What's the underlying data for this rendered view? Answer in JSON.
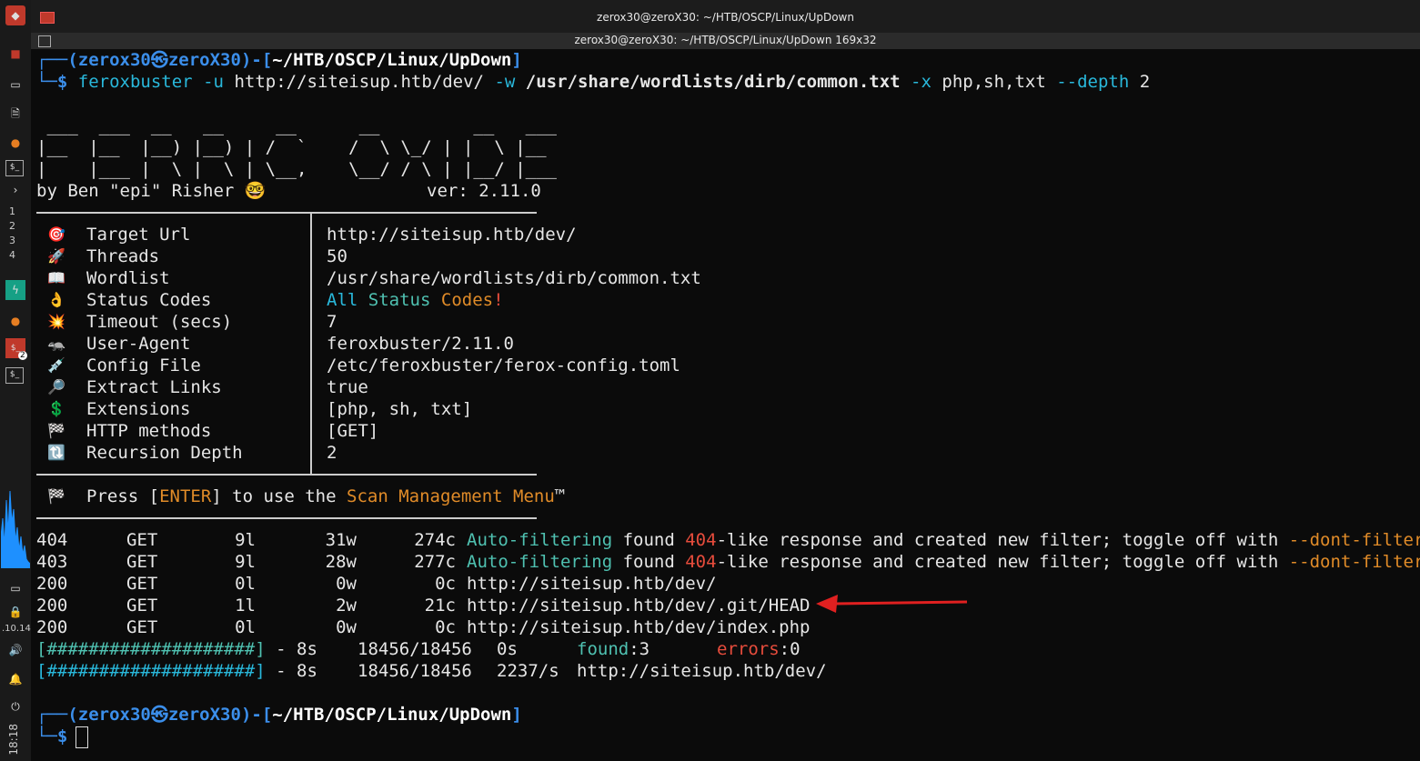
{
  "window": {
    "title": "zerox30@zeroX30: ~/HTB/OSCP/Linux/UpDown",
    "tab_title": "zerox30@zeroX30: ~/HTB/OSCP/Linux/UpDown 169x32"
  },
  "taskbar": {
    "workspaces": [
      "1",
      "2",
      "3",
      "4"
    ],
    "ip": ".10.14",
    "clock": "18:18",
    "badge": "2"
  },
  "prompt": {
    "user": "zerox30",
    "host": "zeroX30",
    "at_symbol": "㉿",
    "path": "~/HTB/OSCP/Linux/UpDown",
    "symbol": "$"
  },
  "command": {
    "bin": "feroxbuster",
    "flag_u": "-u",
    "url": "http://siteisup.htb/dev/",
    "flag_w": "-w",
    "wordlist": "/usr/share/wordlists/dirb/common.txt",
    "flag_x": "-x",
    "exts": "php,sh,txt",
    "flag_depth": "--depth",
    "depth": "2"
  },
  "banner": {
    "art1": " ___  ___  __   __     __      __         __   ___",
    "art2": "|__  |__  |__) |__) | /  `    /  \\ \\_/ | |  \\ |__",
    "art3": "|    |___ |  \\ |  \\ | \\__,    \\__/ / \\ | |__/ |___",
    "author": "by Ben \"epi\" Risher 🤓",
    "version": "ver: 2.11.0"
  },
  "config": [
    {
      "icon": "🎯",
      "label": "Target Url",
      "value": "http://siteisup.htb/dev/"
    },
    {
      "icon": "🚀",
      "label": "Threads",
      "value": "50"
    },
    {
      "icon": "📖",
      "label": "Wordlist",
      "value": "/usr/share/wordlists/dirb/common.txt"
    },
    {
      "icon": "👌",
      "label": "Status Codes",
      "value": ""
    },
    {
      "icon": "💥",
      "label": "Timeout (secs)",
      "value": "7"
    },
    {
      "icon": "🦡",
      "label": "User-Agent",
      "value": "feroxbuster/2.11.0"
    },
    {
      "icon": "💉",
      "label": "Config File",
      "value": "/etc/feroxbuster/ferox-config.toml"
    },
    {
      "icon": "🔎",
      "label": "Extract Links",
      "value": "true"
    },
    {
      "icon": "💲",
      "label": "Extensions",
      "value": "[php, sh, txt]"
    },
    {
      "icon": "🏁",
      "label": "HTTP methods",
      "value": "[GET]"
    },
    {
      "icon": "🔃",
      "label": "Recursion Depth",
      "value": "2"
    }
  ],
  "status_codes": {
    "all": "All",
    "status": "Status",
    "codes": "Codes",
    "bang": "!"
  },
  "press": {
    "icon": "🏁",
    "pre": "Press [",
    "key": "ENTER",
    "mid": "] to use the ",
    "menu": "Scan Management Menu",
    "tm": "™"
  },
  "results": [
    {
      "code": "404",
      "method": "GET",
      "lines": "9l",
      "words": "31w",
      "chars": "274c",
      "af": "Auto-filtering",
      "found": " found ",
      "code2": "404",
      "msg": "-like response and created new filter; toggle off with ",
      "flag": "--dont-filter"
    },
    {
      "code": "403",
      "method": "GET",
      "lines": "9l",
      "words": "28w",
      "chars": "277c",
      "af": "Auto-filtering",
      "found": " found ",
      "code2": "404",
      "msg": "-like response and created new filter; toggle off with ",
      "flag": "--dont-filter"
    },
    {
      "code": "200",
      "method": "GET",
      "lines": "0l",
      "words": "0w",
      "chars": "0c",
      "url": "http://siteisup.htb/dev/"
    },
    {
      "code": "200",
      "method": "GET",
      "lines": "1l",
      "words": "2w",
      "chars": "21c",
      "url": "http://siteisup.htb/dev/.git/HEAD"
    },
    {
      "code": "200",
      "method": "GET",
      "lines": "0l",
      "words": "0w",
      "chars": "0c",
      "url": "http://siteisup.htb/dev/index.php"
    }
  ],
  "progress": [
    {
      "bar": "[####################]",
      "sep": " - ",
      "time": "8s",
      "count": "18456/18456",
      "rate": "0s",
      "found_label": "found",
      "found_val": ":3",
      "errors_label": "errors",
      "errors_val": ":0",
      "fraction": 1.0
    },
    {
      "bar": "[####################]",
      "sep": " - ",
      "time": "8s",
      "count": "18456/18456",
      "rate": "2237/s",
      "url": "http://siteisup.htb/dev/",
      "fraction": 1.0
    }
  ],
  "colors": {
    "accent_blue": "#3b8eea",
    "ok": "#4fc1b1",
    "error": "#e74c3c",
    "warn": "#e08b28",
    "annotation_arrow": "#e02020"
  }
}
